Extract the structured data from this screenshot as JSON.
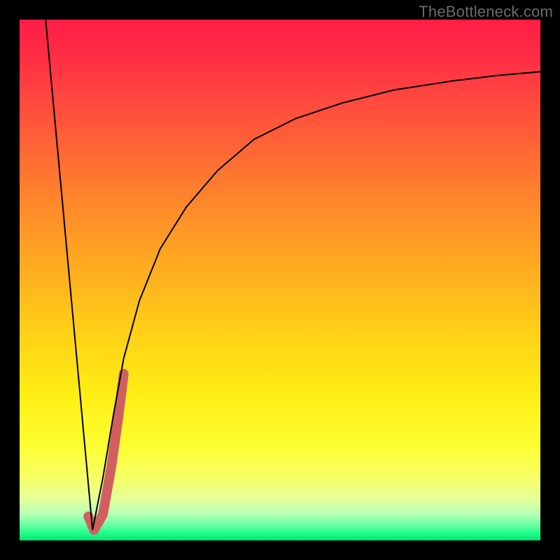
{
  "watermark": "TheBottleneck.com",
  "chart_data": {
    "type": "line",
    "title": "",
    "xlabel": "",
    "ylabel": "",
    "xlim": [
      0,
      100
    ],
    "ylim": [
      0,
      100
    ],
    "grid": false,
    "legend": false,
    "series": [
      {
        "name": "left-descent",
        "x": [
          5,
          14
        ],
        "values": [
          100,
          2
        ],
        "color": "#000000",
        "stroke_width": 2
      },
      {
        "name": "right-log-curve",
        "x": [
          14,
          16,
          18,
          20,
          23,
          27,
          32,
          38,
          45,
          53,
          62,
          72,
          83,
          92,
          100
        ],
        "values": [
          2,
          12,
          24,
          35,
          46,
          56,
          64,
          71,
          77,
          81,
          84,
          86.5,
          88.2,
          89.3,
          90
        ],
        "color": "#000000",
        "stroke_width": 2
      },
      {
        "name": "red-j-segment",
        "x": [
          13.2,
          14.3,
          16.0,
          17.6,
          19.0,
          20.0
        ],
        "values": [
          4.6,
          2.0,
          5.0,
          14.0,
          24.0,
          32.0
        ],
        "color": "#d06060",
        "stroke_width": 14
      }
    ]
  }
}
